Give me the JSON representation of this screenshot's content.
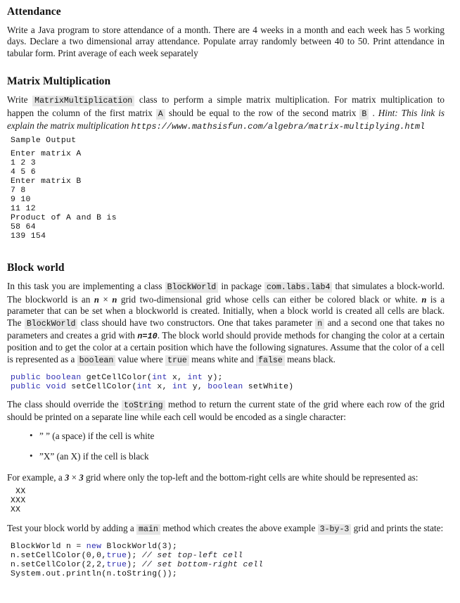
{
  "document": {
    "sections": [
      {
        "id": "attendance",
        "heading": "Attendance",
        "paragraph": "Write a Java program to store attendance of a month. There are 4 weeks in a month and each week has 5 working days. Declare a two dimensional array attendance. Populate array randomly between 40 to 50. Print attendance in tabular form. Print average of each week separately"
      },
      {
        "id": "matrix-multiplication",
        "heading": "Matrix Multiplication",
        "para_part1": "Write",
        "code_class_name": "MatrixMultiplication",
        "para_part2": "class to perform a simple matrix multiplication. For matrix multiplication to happen the column of the first matrix",
        "code_matrix_a": "A",
        "para_part3": "should be equal to the row of the second matrix",
        "code_matrix_b": "B",
        "para_part4": ".",
        "hint_text": "Hint: This link is explain the matrix multiplication",
        "url": "https://www.mathsisfun.com/algebra/matrix-multiplying.html",
        "sample_output_label": "Sample Output",
        "sample_output": "Enter matrix A\n1 2 3\n4 5 6\nEnter matrix B\n7 8\n9 10\n11 12\nProduct of A and B is\n58 64\n139 154"
      },
      {
        "id": "block-world",
        "heading": "Block world",
        "p1_part1": "In this task you are implementing a class",
        "p1_code_blockworld": "BlockWorld",
        "p1_part2": "in package",
        "p1_code_package": "com.labs.lab4",
        "p1_part3": "that simulates a block-world. The blockworld is an",
        "p1_math_n1": "n",
        "p1_times": "×",
        "p1_math_n2": "n",
        "p1_part4": "grid two-dimensional grid whose cells can either be colored black or white.",
        "p1_math_n3": "n",
        "p1_part5": "is a parameter that can be set when a blockworld is created. Initially, when a block world is created all cells are black. The",
        "p1_code_blockworld2": "BlockWorld",
        "p1_part6": "class should have two constructors. One that takes parameter",
        "p1_code_n": "n",
        "p1_part7": "and a second one that takes no parameters and creates a grid with",
        "p1_math_n10": "n=10",
        "p1_part8": ". The block world should provide methods for changing the color at a certain position and to get the color at a certain position which have the following signatures. Assume that the color of a cell is represented as a",
        "p1_code_boolean": "boolean",
        "p1_part9": "value where",
        "p1_code_true": "true",
        "p1_part10": "means white and",
        "p1_code_false": "false",
        "p1_part11": "means black.",
        "signatures": {
          "line1_kw1": "public",
          "line1_kw2": "boolean",
          "line1_name": " getCellColor(",
          "line1_kw3": "int",
          "line1_mid": " x, ",
          "line1_kw4": "int",
          "line1_end": " y);",
          "line2_kw1": "public",
          "line2_kw2": "void",
          "line2_name": " setCellColor(",
          "line2_kw3": "int",
          "line2_mid": " x, ",
          "line2_kw4": "int",
          "line2_mid2": " y, ",
          "line2_kw5": "boolean",
          "line2_end": " setWhite)"
        },
        "p2_part1": "The class should override the",
        "p2_code_tostring": "toString",
        "p2_part2": "method to return the current state of the grid where each row of the grid should be printed on a separate line while each cell would be encoded as a single character:",
        "bullets": [
          "” ” (a space) if the cell is white",
          "”X” (an X) if the cell is black"
        ],
        "p3_part1": "For example, a",
        "p3_math_3a": "3",
        "p3_times": "×",
        "p3_math_3b": "3",
        "p3_part2": "grid where only the top-left and the bottom-right cells are white should be represented as:",
        "grid_output": " XX\nXXX\nXX",
        "p4_part1": "Test your block world by adding a",
        "p4_code_main": "main",
        "p4_part2": "method which creates the above example",
        "p4_code_3by3": "3-by-3",
        "p4_part3": "grid and prints the state:",
        "main_code": {
          "l1_a": "BlockWorld n = ",
          "l1_kw": "new",
          "l1_b": " BlockWorld(3);",
          "l2_a": "n.setCellColor(0,0,",
          "l2_kw": "true",
          "l2_b": "); ",
          "l2_cmt": "// set top-left cell",
          "l3_a": "n.setCellColor(2,2,",
          "l3_kw": "true",
          "l3_b": "); ",
          "l3_cmt": "// set bottom-right cell",
          "l4": "System.out.println(n.toString());"
        }
      }
    ]
  },
  "colors": {
    "keyword": "#2a2ab0",
    "inline_code_bg": "#e6e6e6",
    "text": "#1a1a1a",
    "page_bg": "#ffffff"
  }
}
